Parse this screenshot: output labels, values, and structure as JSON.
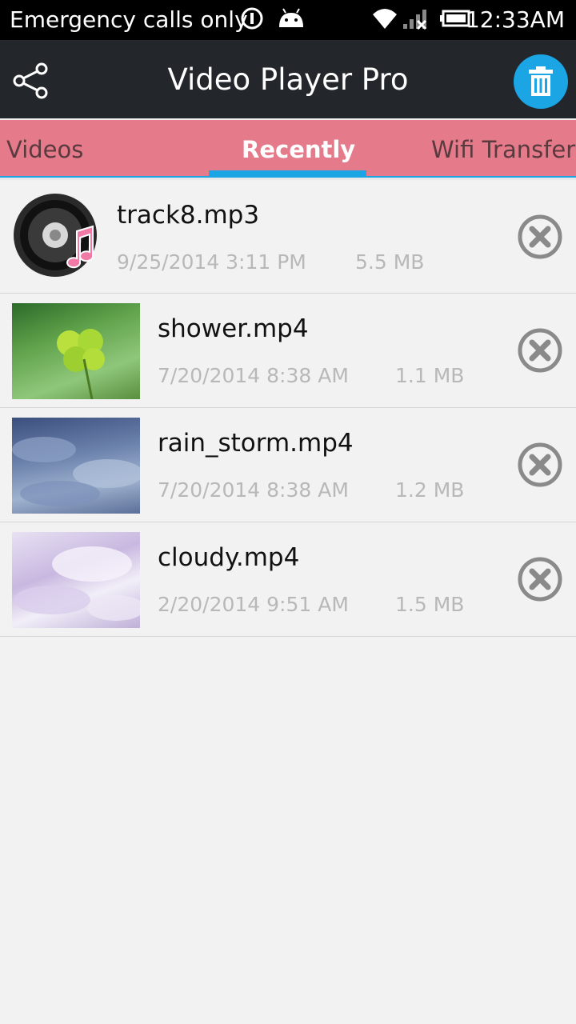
{
  "status_bar": {
    "carrier_text": "Emergency calls only",
    "time": "12:33AM",
    "icons": [
      "sync-icon",
      "android-icon",
      "wifi-icon",
      "signal-icon",
      "battery-icon"
    ]
  },
  "action_bar": {
    "title": "Video Player Pro",
    "share_icon": "share-icon",
    "trash_icon": "trash-icon",
    "accent": "#1ba5e4"
  },
  "tabs": [
    {
      "label": "Videos",
      "active": false
    },
    {
      "label": "Recently",
      "active": true
    },
    {
      "label": "Wifi Transfer",
      "active": false
    }
  ],
  "files": [
    {
      "name": "track8.mp3",
      "date": "9/25/2014 3:11 PM",
      "size": "5.5 MB",
      "thumb": "music-disc-icon"
    },
    {
      "name": "shower.mp4",
      "date": "7/20/2014 8:38 AM",
      "size": "1.1 MB",
      "thumb": "video-thumbnail-clover"
    },
    {
      "name": "rain_storm.mp4",
      "date": "7/20/2014 8:38 AM",
      "size": "1.2 MB",
      "thumb": "video-thumbnail-rain-clouds"
    },
    {
      "name": "cloudy.mp4",
      "date": "2/20/2014 9:51 AM",
      "size": "1.5 MB",
      "thumb": "video-thumbnail-clouds"
    }
  ],
  "colors": {
    "tab_bar": "#e57a8a",
    "action_bar": "#23262b",
    "background": "#f2f2f2"
  }
}
